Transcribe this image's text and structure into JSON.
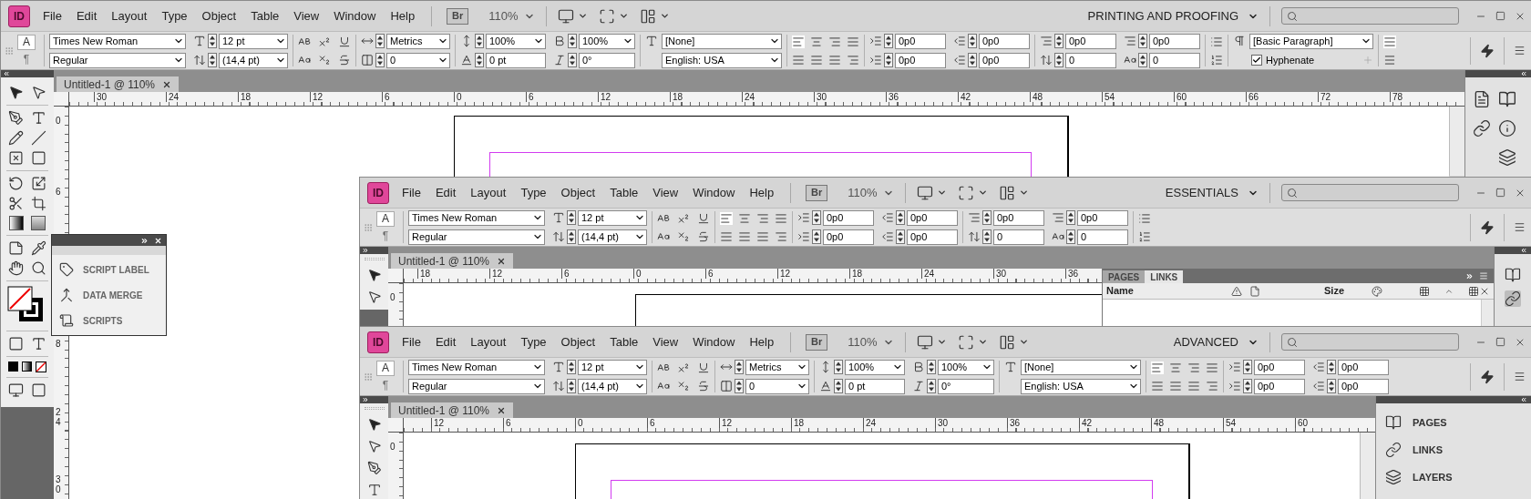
{
  "windows": [
    {
      "logo": "ID",
      "menu": [
        "File",
        "Edit",
        "Layout",
        "Type",
        "Object",
        "Table",
        "View",
        "Window",
        "Help"
      ],
      "bridge": "Br",
      "zoom": "110%",
      "workspace": "PRINTING AND PROOFING",
      "modes": [
        {
          "label": "A",
          "selected": true
        },
        {
          "label": "¶",
          "selected": false
        }
      ],
      "controls": [
        {
          "kind": "font",
          "family": "Times New Roman",
          "style": "Regular",
          "size": "12 pt",
          "leading": "(14,4 pt)"
        },
        {
          "kind": "case"
        },
        {
          "kind": "kerning",
          "kerning": "Metrics",
          "tracking": "0"
        },
        {
          "kind": "scale",
          "vertical": "100%",
          "horizontal": "100%",
          "baseline": "0 pt",
          "skew": "0°"
        },
        {
          "kind": "char-style",
          "style": "[None]",
          "language": "English: USA"
        },
        {
          "kind": "align"
        },
        {
          "kind": "indents",
          "left": "0p0",
          "right": "0p0",
          "first": "0p0",
          "last": "0p0"
        },
        {
          "kind": "spacing",
          "before": "0p0",
          "after": "0p0",
          "drop_lines": "0",
          "drop_chars": "0"
        },
        {
          "kind": "lists"
        },
        {
          "kind": "para-style",
          "style": "[Basic Paragraph]",
          "hyphenate": {
            "label": "Hyphenate",
            "checked": true
          }
        },
        {
          "kind": "columns"
        }
      ],
      "tab": "Untitled-1 @ 110%",
      "ruler": [
        "30",
        "24",
        "18",
        "12",
        "6",
        "0",
        "6",
        "12",
        "18",
        "24",
        "30",
        "36",
        "42",
        "48",
        "54",
        "60",
        "66",
        "72",
        "78"
      ],
      "vruler": [
        "0",
        "6",
        "8",
        "24",
        "30"
      ],
      "script_panel": {
        "items": [
          "SCRIPT LABEL",
          "DATA MERGE",
          "SCRIPTS"
        ]
      }
    },
    {
      "logo": "ID",
      "menu": [
        "File",
        "Edit",
        "Layout",
        "Type",
        "Object",
        "Table",
        "View",
        "Window",
        "Help"
      ],
      "bridge": "Br",
      "zoom": "110%",
      "workspace": "ESSENTIALS",
      "modes": [
        {
          "label": "A",
          "selected": true
        },
        {
          "label": "¶",
          "selected": false
        }
      ],
      "controls": [
        {
          "kind": "font",
          "family": "Times New Roman",
          "style": "Regular",
          "size": "12 pt",
          "leading": "(14,4 pt)"
        },
        {
          "kind": "case"
        },
        {
          "kind": "align"
        },
        {
          "kind": "indents",
          "left": "0p0",
          "right": "0p0",
          "first": "0p0",
          "last": "0p0"
        },
        {
          "kind": "spacing",
          "before": "0p0",
          "after": "0p0",
          "drop_lines": "0",
          "drop_chars": "0"
        },
        {
          "kind": "lists"
        }
      ],
      "tab": "Untitled-1 @ 110%",
      "ruler": [
        "18",
        "12",
        "6",
        "0",
        "6",
        "12",
        "18",
        "24",
        "30",
        "36"
      ],
      "vruler": [
        "0"
      ],
      "links_panel": {
        "tabs": [
          {
            "label": "PAGES",
            "selected": false
          },
          {
            "label": "LINKS",
            "selected": true
          }
        ],
        "columns": [
          "Name",
          "Size"
        ]
      }
    },
    {
      "logo": "ID",
      "menu": [
        "File",
        "Edit",
        "Layout",
        "Type",
        "Object",
        "Table",
        "View",
        "Window",
        "Help"
      ],
      "bridge": "Br",
      "zoom": "110%",
      "workspace": "ADVANCED",
      "modes": [
        {
          "label": "A",
          "selected": true
        },
        {
          "label": "¶",
          "selected": false
        }
      ],
      "controls": [
        {
          "kind": "font",
          "family": "Times New Roman",
          "style": "Regular",
          "size": "12 pt",
          "leading": "(14,4 pt)"
        },
        {
          "kind": "case"
        },
        {
          "kind": "kerning",
          "kerning": "Metrics",
          "tracking": "0"
        },
        {
          "kind": "scale",
          "vertical": "100%",
          "horizontal": "100%",
          "baseline": "0 pt",
          "skew": "0°"
        },
        {
          "kind": "char-style",
          "style": "[None]",
          "language": "English: USA"
        },
        {
          "kind": "align"
        },
        {
          "kind": "indents",
          "left": "0p0",
          "right": "0p0",
          "first": "0p0",
          "last": "0p0"
        }
      ],
      "tab": "Untitled-1 @ 110%",
      "ruler": [
        "12",
        "6",
        "0",
        "6",
        "12",
        "18",
        "24",
        "30",
        "36",
        "42",
        "48",
        "54",
        "60"
      ],
      "vruler": [
        "0"
      ],
      "dock_items": [
        "PAGES",
        "LINKS",
        "LAYERS"
      ]
    }
  ]
}
